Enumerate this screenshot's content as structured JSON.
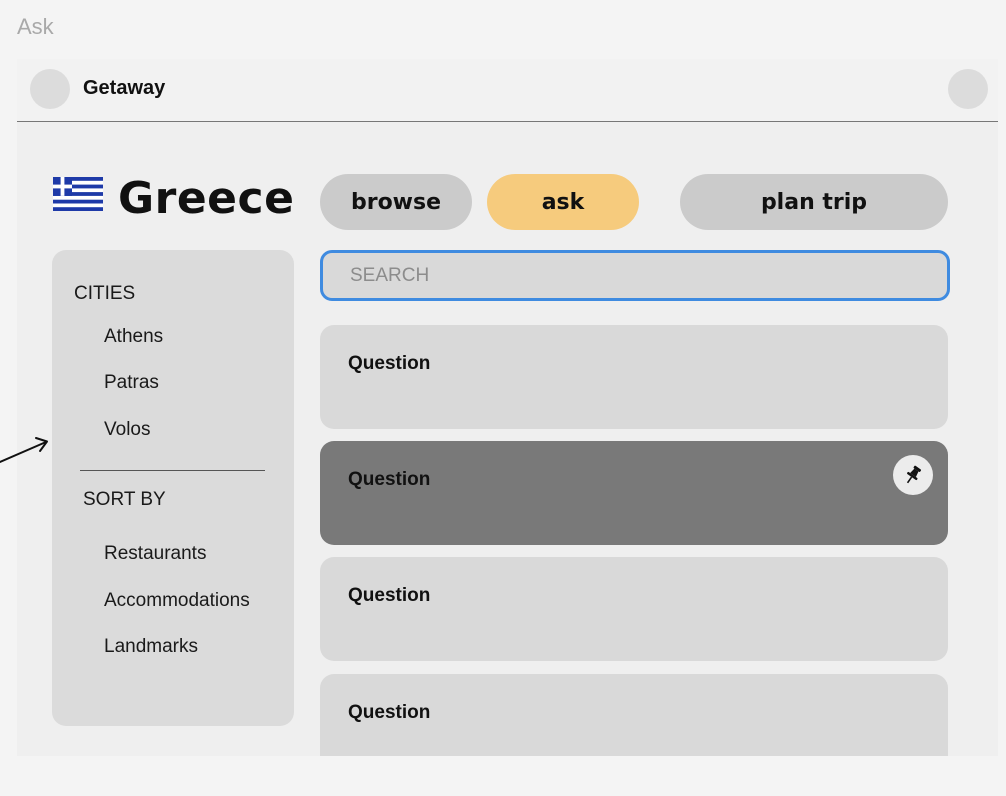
{
  "frame": {
    "label": "Ask"
  },
  "header": {
    "title": "Getaway"
  },
  "page": {
    "country": "Greece",
    "flag_icon": "greece-flag-icon"
  },
  "tabs": [
    {
      "label": "browse",
      "active": false
    },
    {
      "label": "ask",
      "active": true
    },
    {
      "label": "plan trip",
      "active": false
    }
  ],
  "search": {
    "placeholder": "SEARCH",
    "value": ""
  },
  "sidebar": {
    "cities_label": "CITIES",
    "cities": [
      "Athens",
      "Patras",
      "Volos"
    ],
    "sort_label": "SORT BY",
    "sort_options": [
      "Restaurants",
      "Accommodations",
      "Landmarks"
    ]
  },
  "questions": [
    {
      "title": "Question",
      "selected": false
    },
    {
      "title": "Question",
      "selected": true,
      "icon": "pin-icon"
    },
    {
      "title": "Question",
      "selected": false
    },
    {
      "title": "Question",
      "selected": false
    }
  ],
  "colors": {
    "active_tab": "#f6cb7d",
    "tab": "#cbcbcb",
    "search_border": "#3f8be0",
    "selected_card": "#797979",
    "card": "#d9d9d9"
  }
}
